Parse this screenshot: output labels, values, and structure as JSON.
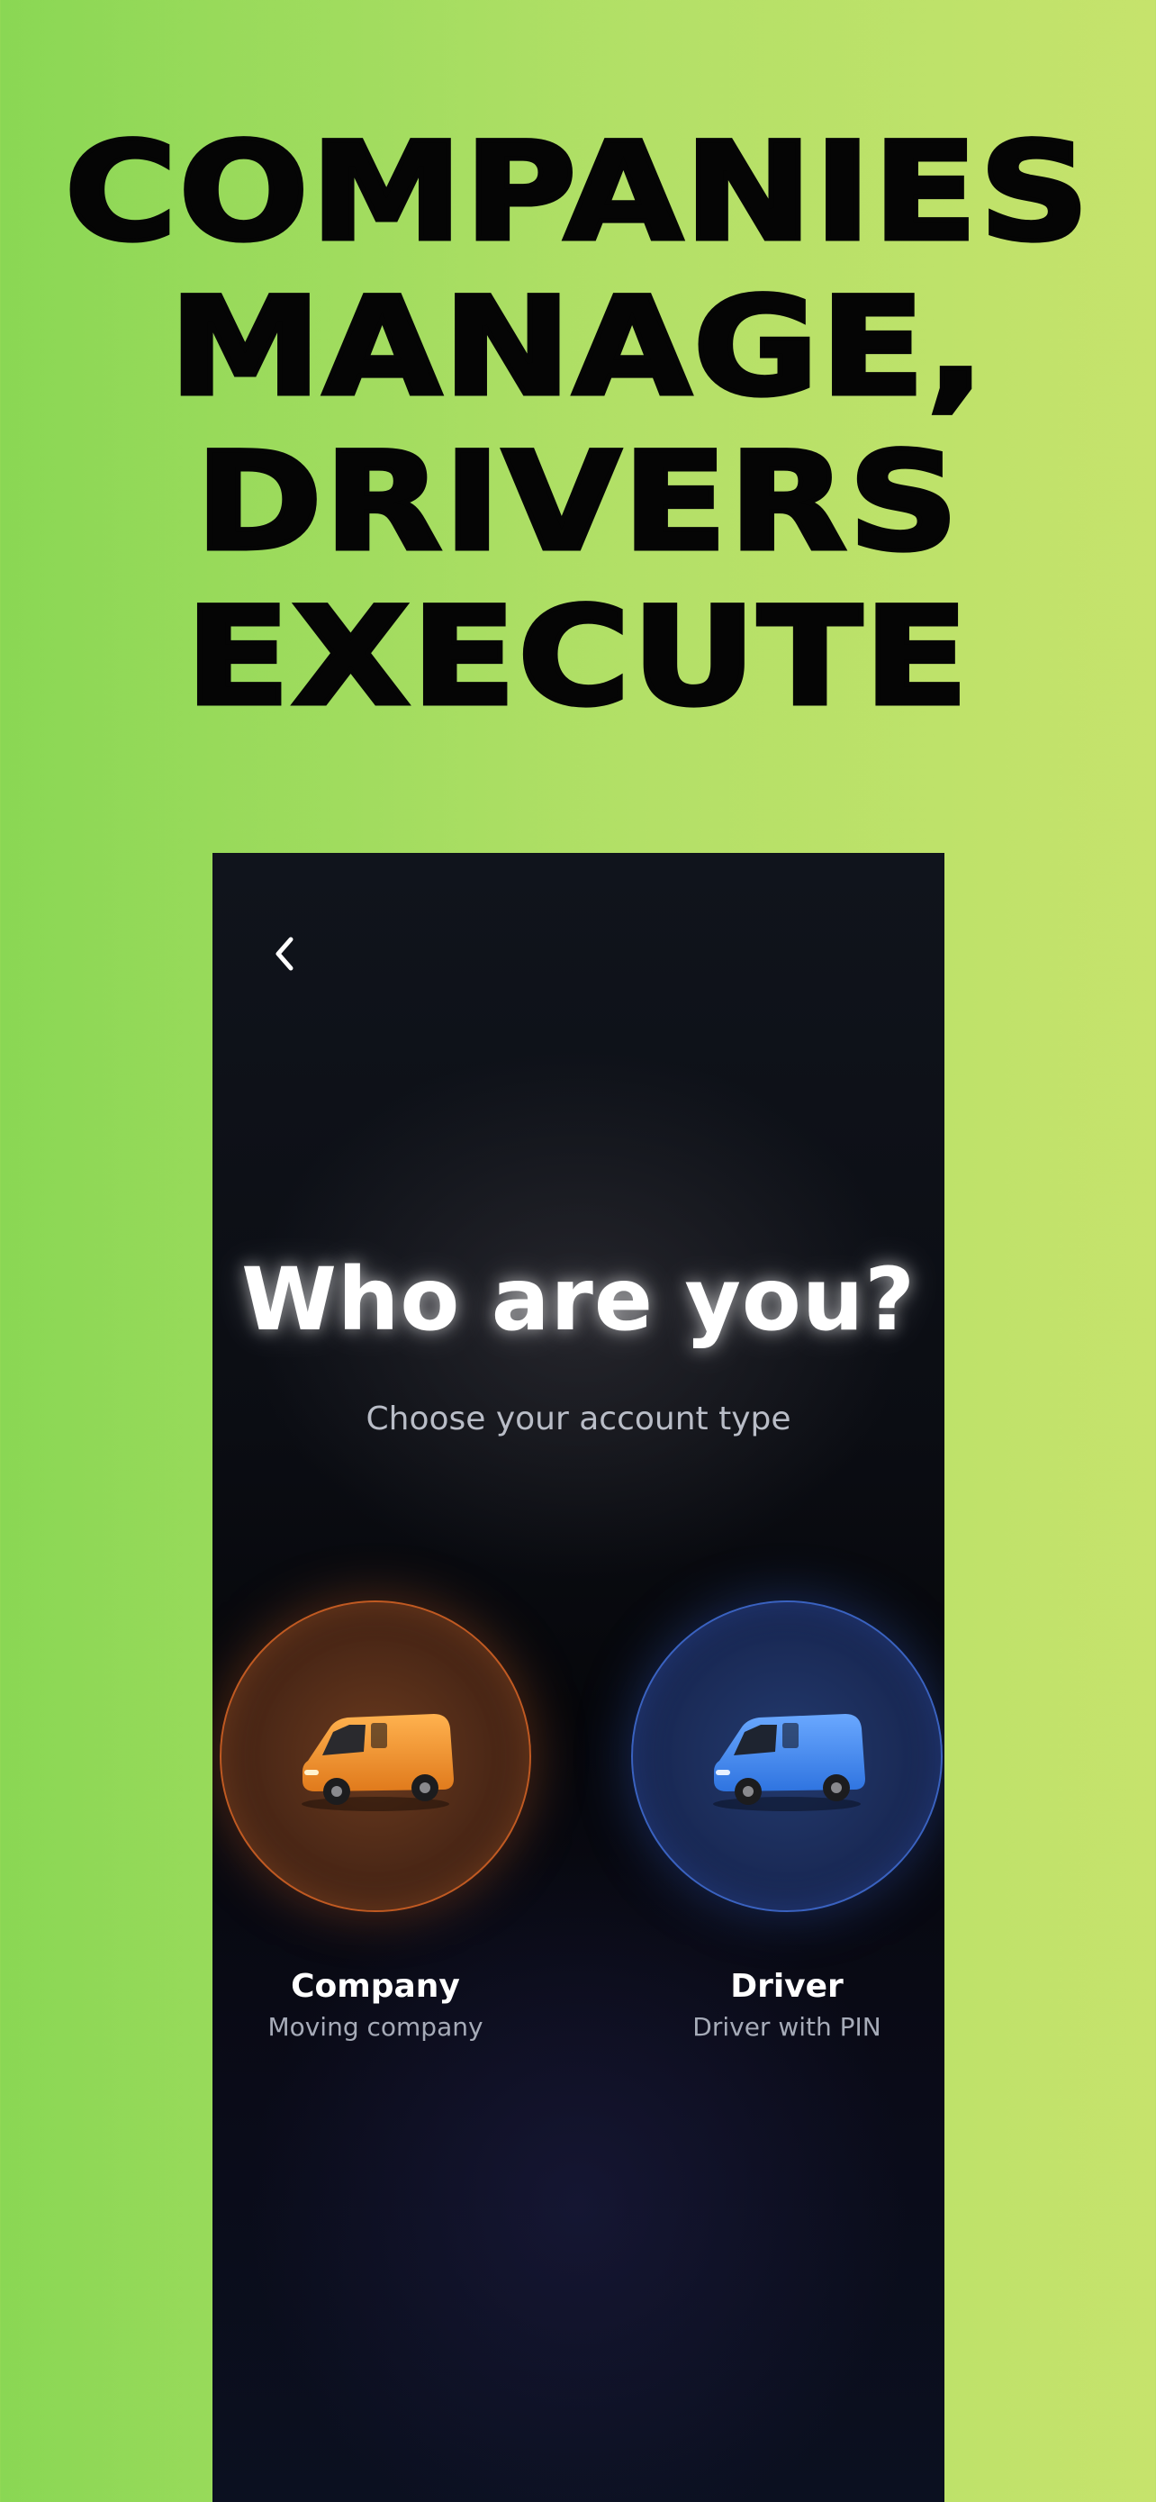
{
  "headline": {
    "lines": [
      "COMPANIES",
      "MANAGE,",
      "DRIVERS",
      "EXECUTE"
    ]
  },
  "screen": {
    "back_icon": "chevron-left-icon",
    "title": "Who are you?",
    "subtitle": "Choose your account type",
    "options": [
      {
        "label": "Company",
        "description": "Moving company",
        "icon": "van-icon",
        "accent": "#f0902e"
      },
      {
        "label": "Driver",
        "description": "Driver with PIN",
        "icon": "van-icon",
        "accent": "#4a8ff0"
      }
    ]
  },
  "colors": {
    "background_left": "#8ad754",
    "background_right": "#c6e36c",
    "headline": "#050505",
    "screen_bg": "#0b0d13"
  }
}
